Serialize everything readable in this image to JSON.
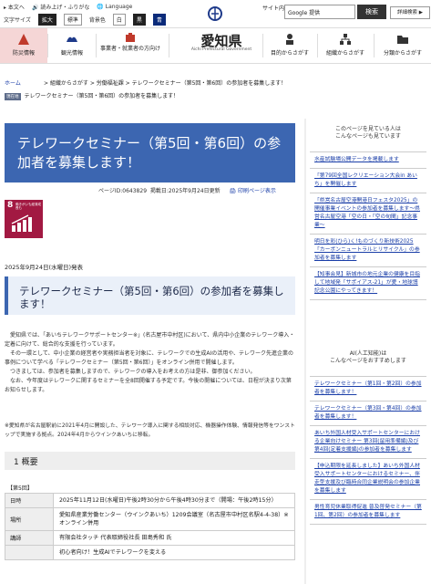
{
  "util": {
    "home": "本文へ",
    "read_aloud": "読み上げ・ふりがな",
    "language": "Language",
    "font_size": "文字サイズ",
    "enlarge": "拡大",
    "standard": "標準",
    "bg_color": "背景色",
    "white": "白",
    "black": "黒",
    "blue": "青",
    "site_search": "サイト内検索",
    "search_placeholder": "Google 提供",
    "search_button": "検索",
    "advanced_search": "詳細検索 ▶"
  },
  "nav": {
    "items": [
      {
        "label": "防災情報"
      },
      {
        "label": "観光情報"
      },
      {
        "label": "事業者・就業者の方向け"
      },
      {
        "label": "目的からさがす"
      },
      {
        "label": "組織からさがす"
      },
      {
        "label": "分類からさがす"
      }
    ],
    "pref_name": "愛知県",
    "pref_en": "Aichi Prefectural Government"
  },
  "breadcrumb": {
    "home": "ホーム",
    "trail": "> 組織からさがす > 労働福祉課 > テレワークセミナー（第5回・第6回）の参加者を募集します！",
    "here_tag": "現在地",
    "here_text": "テレワークセミナー（第5回・第6回）の参加者を募集します！"
  },
  "article": {
    "title": "テレワークセミナー（第5回・第6回）の参加者を募集します！",
    "page_id": "ページID:0643829",
    "updated": "掲載日:2025年9月24日更新",
    "print": "印刷ページ表示",
    "sdg_number": "8",
    "sdg_label": "働きがいも経済成長も",
    "date": "2025年9月24日(水曜日)発表",
    "heading": "テレワークセミナー（第5回・第6回）の参加者を募集します！",
    "paragraphs": [
      "愛知県では、「あいちテレワークサポートセンター※」(名古屋市中村区)において、県内中小企業のテレワーク導入・定着に向けて、総合的な支援を行っています。",
      "その一環として、中小企業の経営者や実務担当者を対象に、テレワークでの生成AIの活用や、テレワーク先進企業の事例について学べる「テレワークセミナー（第5回・第6回）」をオンライン併用で開催します。",
      "つきましては、参加者を募集しますので、テレワークの導入をお考えの方は是非、御参加ください。",
      "なお、今年度はテレワークに関するセミナーを全8回開催する予定です。今後の開催については、日程が決まり次第お知らせします。"
    ],
    "note": "※愛知県が名古屋駅前に2021年4月に開設した、テレワーク導入に関する相談対応、機器操作体験、情報発信等をワンストップで実施する拠点。2024年4月からウインクあいちに移転。",
    "section": "1 概要",
    "session": "【第5回】",
    "table": [
      {
        "th": "日時",
        "td": "2025年11月12日(水曜日)午後2時30分から午後4時30分まで（開場：午後2時15分）"
      },
      {
        "th": "場所",
        "td": "愛知県産業労働センター（ウインクあいち）1209会議室（名古屋市中村区名駅4-4-38）※オンライン併用"
      },
      {
        "th": "講師",
        "td": "有限会社タッチ 代表取締役社長 田島秀和 氏"
      },
      {
        "th": "",
        "td": "初心者向け！生成AIでテレワークを変える"
      }
    ]
  },
  "sidebar": {
    "head1": "このページを見ている人は\nこんなページも見ています",
    "list1": [
      "水産試験場公開データを掲載します",
      "「第79回全国レクリエーション大会in あいち」を開催します",
      "「県営名古屋空港開港日フェスタ2025」の開催事業イベントの参加者を募集します～県営名古屋空港「空の日・「空の旬間」記念事業～",
      "明日を彩(ひら)く!ものづくり新技術2025「カーボンニュートラルとリサイクル」の参加者を募集します",
      "【知事会見】新城市の地元企業の健康を目指して地域発「サポイアス-21」が愛・地球博記念公園にやってきます！"
    ],
    "head2": "AI(人工知能)は\nこんなページをおすすめします",
    "list2": [
      "テレワークセミナー（第1回・第2回）の参加者を募集します！",
      "テレワークセミナー（第3回・第4回）の参加者を募集します！",
      "あいち外国人材受入サポートセンターにおける企業向けセミナー 第3回(留用準備編)及び第4回(定着支援編)の参加者を募集します",
      "【申込期限を延長しました】あいち外国人材受入サポートセンターにおけるセミナー、伴走型支援及び臨時合同企業説明会の参加企業を募集します",
      "男性育児休業取得促進 普及啓発セミナー（第1回、第2回）の参加者を募集します"
    ]
  },
  "colors": {
    "title_bg": "#3c66b1",
    "sdg": "#a21942",
    "link": "#1a3ea8"
  }
}
